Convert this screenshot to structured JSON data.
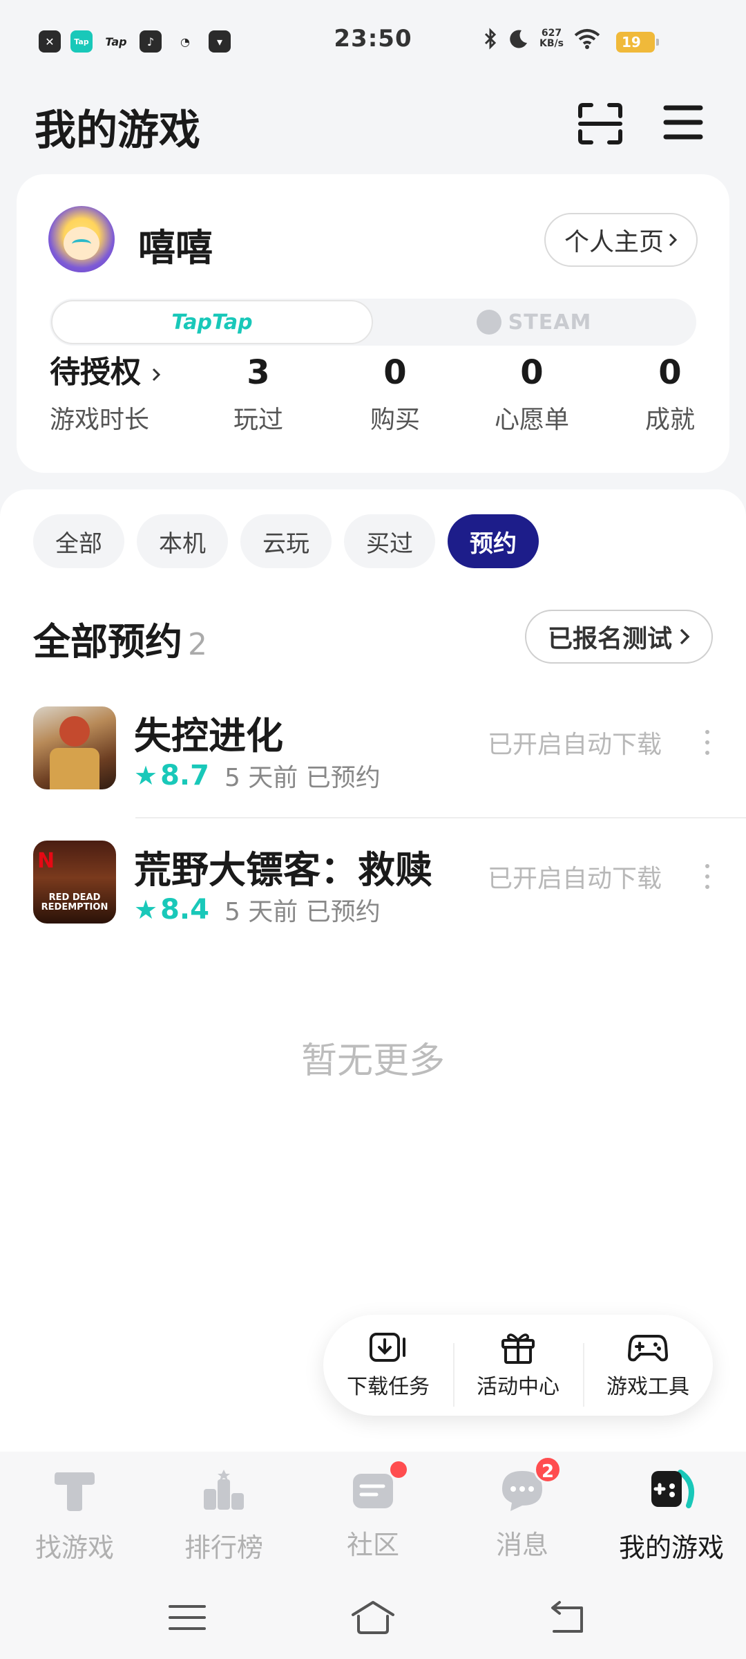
{
  "status_bar": {
    "time": "23:50",
    "apps": [
      {
        "icon": "close-app-icon",
        "glyph": "✕"
      },
      {
        "icon": "taptap-app-icon",
        "glyph": "Tap"
      },
      {
        "icon": "tap-text-icon",
        "glyph": "Tap"
      },
      {
        "icon": "music-app-icon",
        "glyph": "♪"
      },
      {
        "icon": "wechat-icon",
        "glyph": "◔"
      },
      {
        "icon": "bag-app-icon",
        "glyph": "▾"
      }
    ],
    "net_speed_value": "627",
    "net_speed_unit": "KB/s",
    "battery": "19"
  },
  "header": {
    "title": "我的游戏"
  },
  "profile": {
    "username": "嘻嘻",
    "homepage_label": "个人主页",
    "platforms": [
      {
        "label": "TapTap",
        "active": true
      },
      {
        "label": "STEAM",
        "active": false
      }
    ],
    "auth_label": "待授权",
    "play_time_label": "游戏时长",
    "stats": [
      {
        "value": "3",
        "label": "玩过"
      },
      {
        "value": "0",
        "label": "购买"
      },
      {
        "value": "0",
        "label": "心愿单"
      },
      {
        "value": "0",
        "label": "成就"
      }
    ]
  },
  "filters": [
    "全部",
    "本机",
    "云玩",
    "买过",
    "预约"
  ],
  "active_filter": "预约",
  "section": {
    "title": "全部预约",
    "count": "2",
    "signed_test_label": "已报名测试"
  },
  "games": [
    {
      "name": "失控进化",
      "rating": "8.7",
      "meta": "5 天前 已预约",
      "status": "已开启自动下载"
    },
    {
      "name": "荒野大镖客：救赎",
      "rating": "8.4",
      "meta": "5 天前 已预约",
      "status": "已开启自动下载",
      "icon_text_brand": "N",
      "icon_text_title": "RED DEAD REDEMPTION"
    }
  ],
  "empty_hint": "暂无更多",
  "floating_tools": [
    {
      "label": "下载任务",
      "icon": "download-task-icon"
    },
    {
      "label": "活动中心",
      "icon": "gift-icon"
    },
    {
      "label": "游戏工具",
      "icon": "gamepad-icon"
    }
  ],
  "bottom_nav": [
    {
      "label": "找游戏",
      "icon": "find-game-icon"
    },
    {
      "label": "排行榜",
      "icon": "ranking-icon"
    },
    {
      "label": "社区",
      "icon": "community-icon",
      "dot": true
    },
    {
      "label": "消息",
      "icon": "message-icon",
      "badge": "2"
    },
    {
      "label": "我的游戏",
      "icon": "my-games-icon",
      "active": true
    }
  ],
  "colors": {
    "accent": "#19c8b9",
    "active_chip": "#1d1d8a",
    "badge": "#ff4d4f"
  }
}
